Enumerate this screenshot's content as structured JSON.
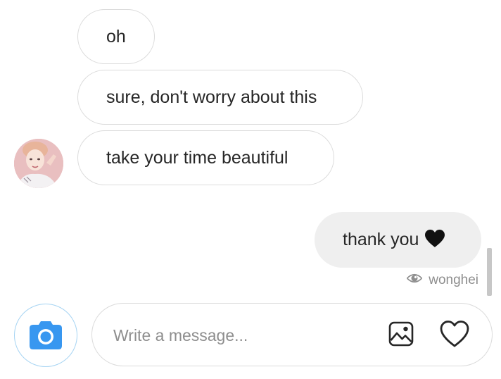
{
  "messages": [
    {
      "text": "oh",
      "direction": "received"
    },
    {
      "text": "sure, don't worry about this",
      "direction": "received"
    },
    {
      "text": "take your time beautiful",
      "direction": "received"
    },
    {
      "text": "thank you",
      "direction": "sent",
      "emoji": "black-heart"
    }
  ],
  "seen": {
    "icon": "eye-icon",
    "by": "wonghei"
  },
  "composer": {
    "placeholder": "Write a message...",
    "value": ""
  },
  "icons": {
    "camera": "camera-icon",
    "gallery": "gallery-icon",
    "like": "heart-icon"
  },
  "colors": {
    "accent": "#3897f0",
    "received_border": "#dbdbdb",
    "sent_background": "#efefef",
    "muted_text": "#8e8e8e"
  }
}
